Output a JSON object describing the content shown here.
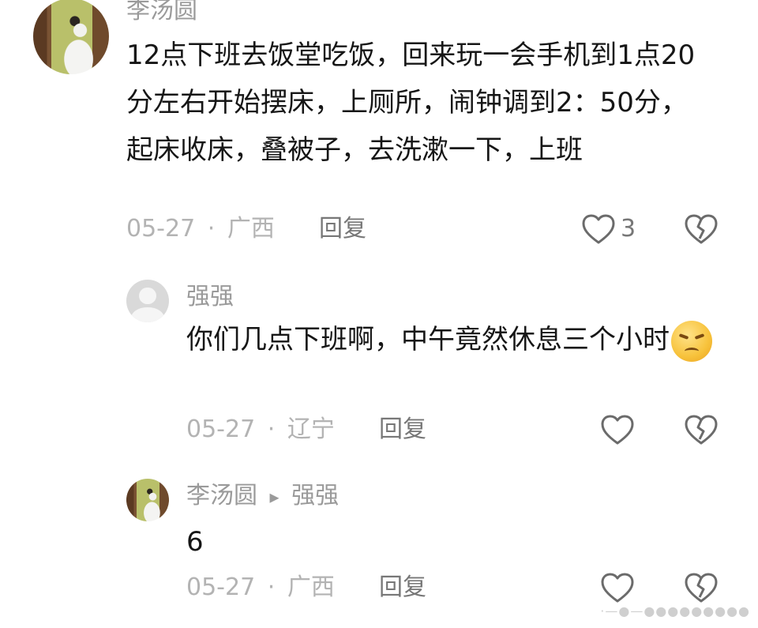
{
  "comments": [
    {
      "username": "李汤圆",
      "text": "12点下班去饭堂吃饭，回来玩一会手机到1点20分左右开始摆床，上厕所，闹钟调到2：50分，起床收床，叠被子，去洗漱一下，上班",
      "date": "05-27",
      "separator": "·",
      "location": "广西",
      "reply_label": "回复",
      "like_count": "3"
    }
  ],
  "replies": [
    {
      "username": "强强",
      "text": "你们几点下班啊，中午竟然休息三个小时",
      "emoji": "angry-face-emoji",
      "date": "05-27",
      "separator": "·",
      "location": "辽宁",
      "reply_label": "回复"
    },
    {
      "username": "李汤圆",
      "reply_arrow": "▸",
      "reply_to": "强强",
      "text": "6",
      "date": "05-27",
      "separator": "·",
      "location": "广西",
      "reply_label": "回复"
    }
  ],
  "watermark": "·—●—●●●●●●●●●"
}
